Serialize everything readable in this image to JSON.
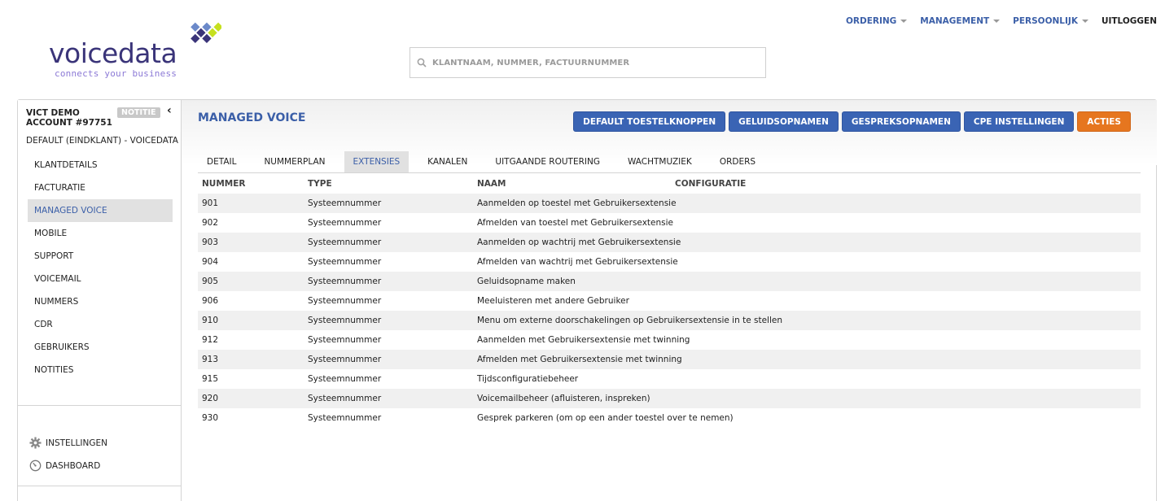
{
  "brand": {
    "name": "voicedata",
    "tagline": "connects your business"
  },
  "topnav": {
    "items": [
      "ORDERING",
      "MANAGEMENT",
      "PERSOONLIJK"
    ],
    "logout": "UITLOGGEN"
  },
  "search": {
    "placeholder": "KLANTNAAM, NUMMER, FACTUURNUMMER"
  },
  "account": {
    "name": "VICT DEMO",
    "number": "ACCOUNT #97751",
    "badge": "NOTITIE",
    "subtitle": "DEFAULT (EINDKLANT) - VOICEDATA"
  },
  "sidebar": {
    "items": [
      {
        "label": "KLANTDETAILS"
      },
      {
        "label": "FACTURATIE"
      },
      {
        "label": "MANAGED VOICE"
      },
      {
        "label": "MOBILE"
      },
      {
        "label": "SUPPORT"
      },
      {
        "label": "VOICEMAIL"
      },
      {
        "label": "NUMMERS"
      },
      {
        "label": "CDR"
      },
      {
        "label": "GEBRUIKERS"
      },
      {
        "label": "NOTITIES"
      }
    ],
    "active_index": 2,
    "settings_label": "INSTELLINGEN",
    "dashboard_label": "DASHBOARD"
  },
  "main": {
    "title": "MANAGED VOICE",
    "actions": [
      "DEFAULT TOESTELKNOPPEN",
      "GELUIDSOPNAMEN",
      "GESPREKSOPNAMEN",
      "CPE INSTELLINGEN",
      "ACTIES"
    ],
    "tabs": [
      "DETAIL",
      "NUMMERPLAN",
      "EXTENSIES",
      "KANALEN",
      "UITGAANDE ROUTERING",
      "WACHTMUZIEK",
      "ORDERS"
    ],
    "active_tab": 2,
    "table": {
      "headers": [
        "NUMMER",
        "TYPE",
        "NAAM",
        "CONFIGURATIE"
      ],
      "rows": [
        [
          "901",
          "Systeemnummer",
          "Aanmelden op toestel met Gebruikersextensie",
          ""
        ],
        [
          "902",
          "Systeemnummer",
          "Afmelden van toestel met Gebruikersextensie",
          ""
        ],
        [
          "903",
          "Systeemnummer",
          "Aanmelden op wachtrij met Gebruikersextensie",
          ""
        ],
        [
          "904",
          "Systeemnummer",
          "Afmelden van wachtrij met Gebruikersextensie",
          ""
        ],
        [
          "905",
          "Systeemnummer",
          "Geluidsopname maken",
          ""
        ],
        [
          "906",
          "Systeemnummer",
          "Meeluisteren met andere Gebruiker",
          ""
        ],
        [
          "910",
          "Systeemnummer",
          "Menu om externe doorschakelingen op Gebruikersextensie in te stellen",
          ""
        ],
        [
          "912",
          "Systeemnummer",
          "Aanmelden met Gebruikersextensie met twinning",
          ""
        ],
        [
          "913",
          "Systeemnummer",
          "Afmelden met Gebruikersextensie met twinning",
          ""
        ],
        [
          "915",
          "Systeemnummer",
          "Tijdsconfiguratiebeheer",
          ""
        ],
        [
          "920",
          "Systeemnummer",
          "Voicemailbeheer (afluisteren, inspreken)",
          ""
        ],
        [
          "930",
          "Systeemnummer",
          "Gesprek parkeren (om op een ander toestel over te nemen)",
          ""
        ]
      ]
    }
  },
  "colors": {
    "brand_dark": "#3a3479",
    "link_blue": "#3b5fa8",
    "button_blue": "#3a64b4",
    "button_orange": "#e6761f",
    "active_bg": "#e1e1e1",
    "logo_lime": "#c6e01f"
  },
  "icons": {
    "search": "magnifier-icon",
    "settings": "gear-icon",
    "dashboard": "gauge-icon",
    "collapse": "chevron-left-icon"
  }
}
